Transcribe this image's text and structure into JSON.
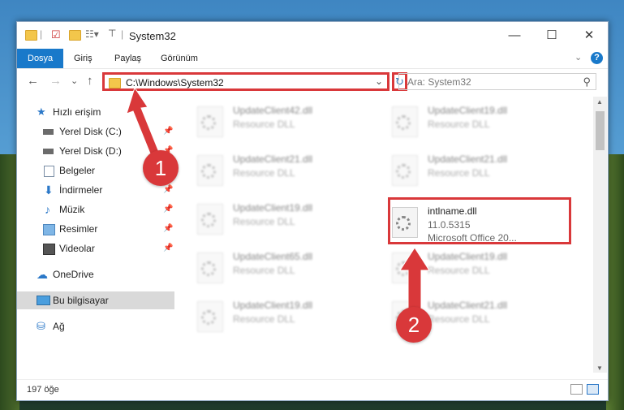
{
  "window": {
    "title": "System32"
  },
  "ribbon": {
    "tabs": [
      "Dosya",
      "Giriş",
      "Paylaş",
      "Görünüm"
    ],
    "help_label": "?"
  },
  "window_controls": {
    "minimize": "—",
    "maximize": "☐",
    "close": "✕"
  },
  "nav": {
    "back": "←",
    "forward": "→",
    "recent": "⌄",
    "up": "↑",
    "address": "C:\\Windows\\System32",
    "address_chevron": "⌄",
    "refresh": "↻",
    "search_placeholder": "Ara: System32",
    "search_icon": "⚲"
  },
  "sidebar": {
    "items": [
      {
        "label": "Hızlı erişim",
        "icon": "star-icon",
        "pinned": false
      },
      {
        "label": "Yerel Disk (C:)",
        "icon": "drive-icon",
        "pinned": true
      },
      {
        "label": "Yerel Disk (D:)",
        "icon": "drive-icon",
        "pinned": true
      },
      {
        "label": "Belgeler",
        "icon": "documents-icon",
        "pinned": true
      },
      {
        "label": "İndirmeler",
        "icon": "download-icon",
        "pinned": true
      },
      {
        "label": "Müzik",
        "icon": "music-icon",
        "pinned": true
      },
      {
        "label": "Resimler",
        "icon": "pictures-icon",
        "pinned": true
      },
      {
        "label": "Videolar",
        "icon": "videos-icon",
        "pinned": true
      },
      {
        "label": "OneDrive",
        "icon": "cloud-icon",
        "pinned": false
      },
      {
        "label": "Bu bilgisayar",
        "icon": "computer-icon",
        "pinned": false
      },
      {
        "label": "Ağ",
        "icon": "network-icon",
        "pinned": false
      }
    ],
    "pin_glyph": "📌"
  },
  "files": [
    {
      "name": "UpdateClient42.dll",
      "type": "Resource DLL"
    },
    {
      "name": "UpdateClient19.dll",
      "type": "Resource DLL"
    },
    {
      "name": "UpdateClient21.dll",
      "type": "Resource DLL"
    },
    {
      "name": "UpdateClient21.dll",
      "type": "Resource DLL"
    },
    {
      "name": "UpdateClient19.dll",
      "type": "Resource DLL"
    },
    {
      "name": "intlname.dll",
      "version": "11.0.5315",
      "description": "Microsoft Office 20..."
    },
    {
      "name": "UpdateClient65.dll",
      "type": "Resource DLL"
    },
    {
      "name": "UpdateClient19.dll",
      "type": "Resource DLL"
    },
    {
      "name": "UpdateClient19.dll",
      "type": "Resource DLL"
    },
    {
      "name": "UpdateClient21.dll",
      "type": "Resource DLL"
    }
  ],
  "status": {
    "item_count": "197 öğe"
  },
  "markers": {
    "one": "1",
    "two": "2"
  },
  "colors": {
    "accent": "#1979ca",
    "highlight": "#d9383a"
  }
}
